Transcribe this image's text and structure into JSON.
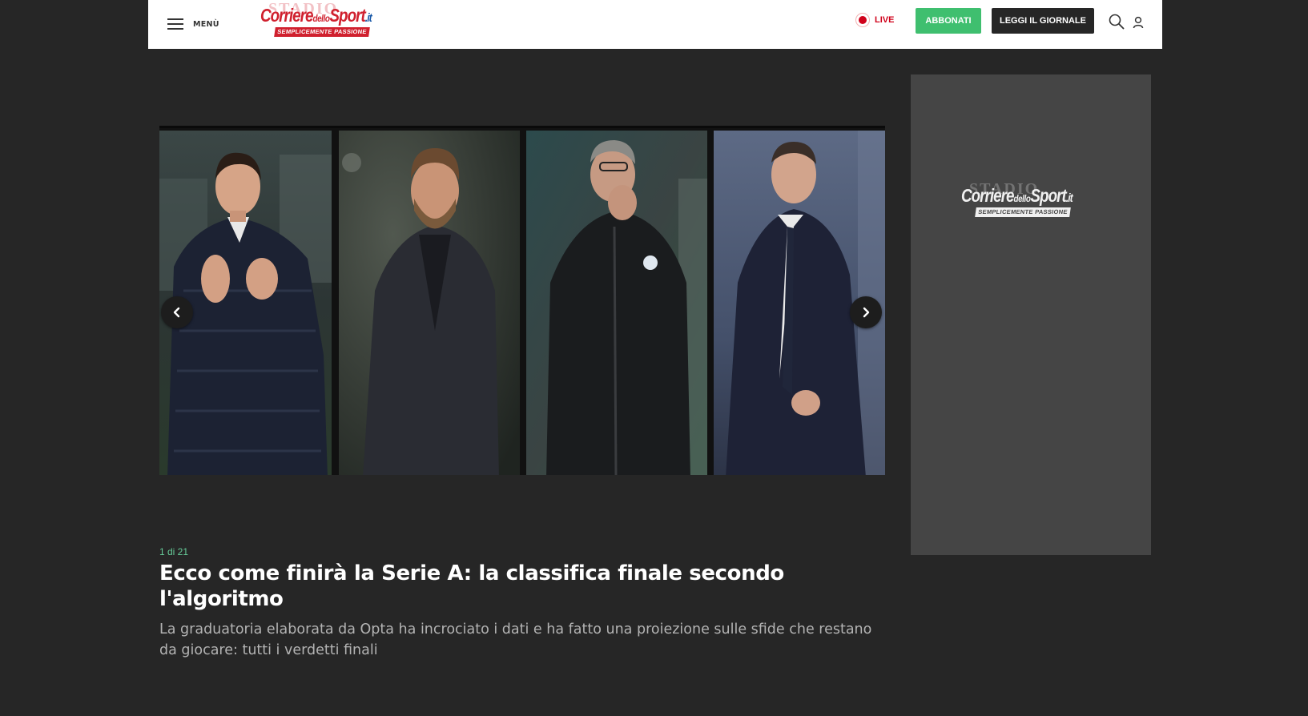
{
  "header": {
    "menu_label": "MENÙ",
    "logo": {
      "ghost": "STADIO",
      "main": "Corriere",
      "middle": "dello",
      "sport": "Sport",
      "tld": ".it",
      "tagline": "SEMPLICEMENTE PASSIONE"
    },
    "live_label": "LIVE",
    "subscribe_label": "ABBONATI",
    "read_paper_label": "LEGGI IL GIORNALE",
    "icons": [
      "menu-icon",
      "live-dot-icon",
      "search-icon",
      "user-icon"
    ]
  },
  "gallery": {
    "counter": "1 di 21",
    "title": "Ecco come finirà la Serie A: la classifica finale secondo l'algoritmo",
    "summary": "La graduatoria elaborata da Opta ha incrociato i dati e ha fatto una proiezione sulle sfide che restano da giocare: tutti i verdetti finali",
    "prev_icon": "chevron-left-icon",
    "next_icon": "chevron-right-icon"
  },
  "sidebar_ad": {
    "logo": {
      "ghost": "STADIO",
      "main": "Corriere",
      "middle": "dello",
      "sport": "Sport",
      "tld": ".it",
      "tagline": "SEMPLICEMENTE PASSIONE"
    }
  },
  "colors": {
    "page_bg": "#262626",
    "header_bg": "#ffffff",
    "brand_red": "#d0202e",
    "subscribe_green": "#3fbf6f",
    "counter_green": "#66cc99",
    "ad_bg": "#454545"
  }
}
